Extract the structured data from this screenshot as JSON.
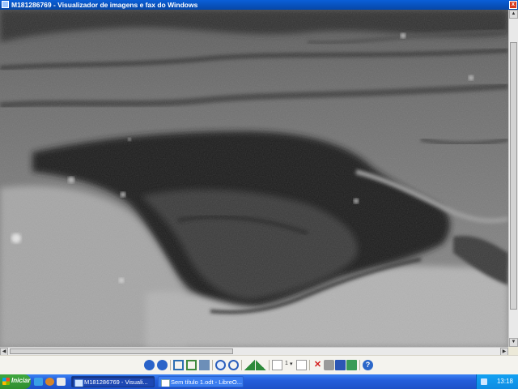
{
  "window": {
    "title": "M181286769 - Visualizador de imagens e fax do Windows",
    "close_glyph": "x"
  },
  "viewer": {
    "image_description_name": "lunar-crater-image"
  },
  "toolbar": {
    "page_indicator": "1",
    "buttons": [
      "previous-image",
      "next-image",
      "best-fit",
      "actual-size",
      "slideshow",
      "zoom-in",
      "zoom-out",
      "rotate-clockwise",
      "rotate-counterclockwise",
      "previous-page",
      "page-select",
      "next-page",
      "delete",
      "print",
      "save",
      "open-editor",
      "help"
    ]
  },
  "taskbar": {
    "start_label": "Iniciar",
    "tasks": [
      {
        "label": "M181286769 - Visuali...",
        "active": true
      },
      {
        "label": "Sem título 1.odt - LibreO...",
        "active": false
      }
    ],
    "clock": "13:18"
  },
  "colors": {
    "titlebar": "#0747a6",
    "taskbar": "#245edb",
    "start": "#2f8d2f",
    "tray": "#0f8ce3"
  }
}
